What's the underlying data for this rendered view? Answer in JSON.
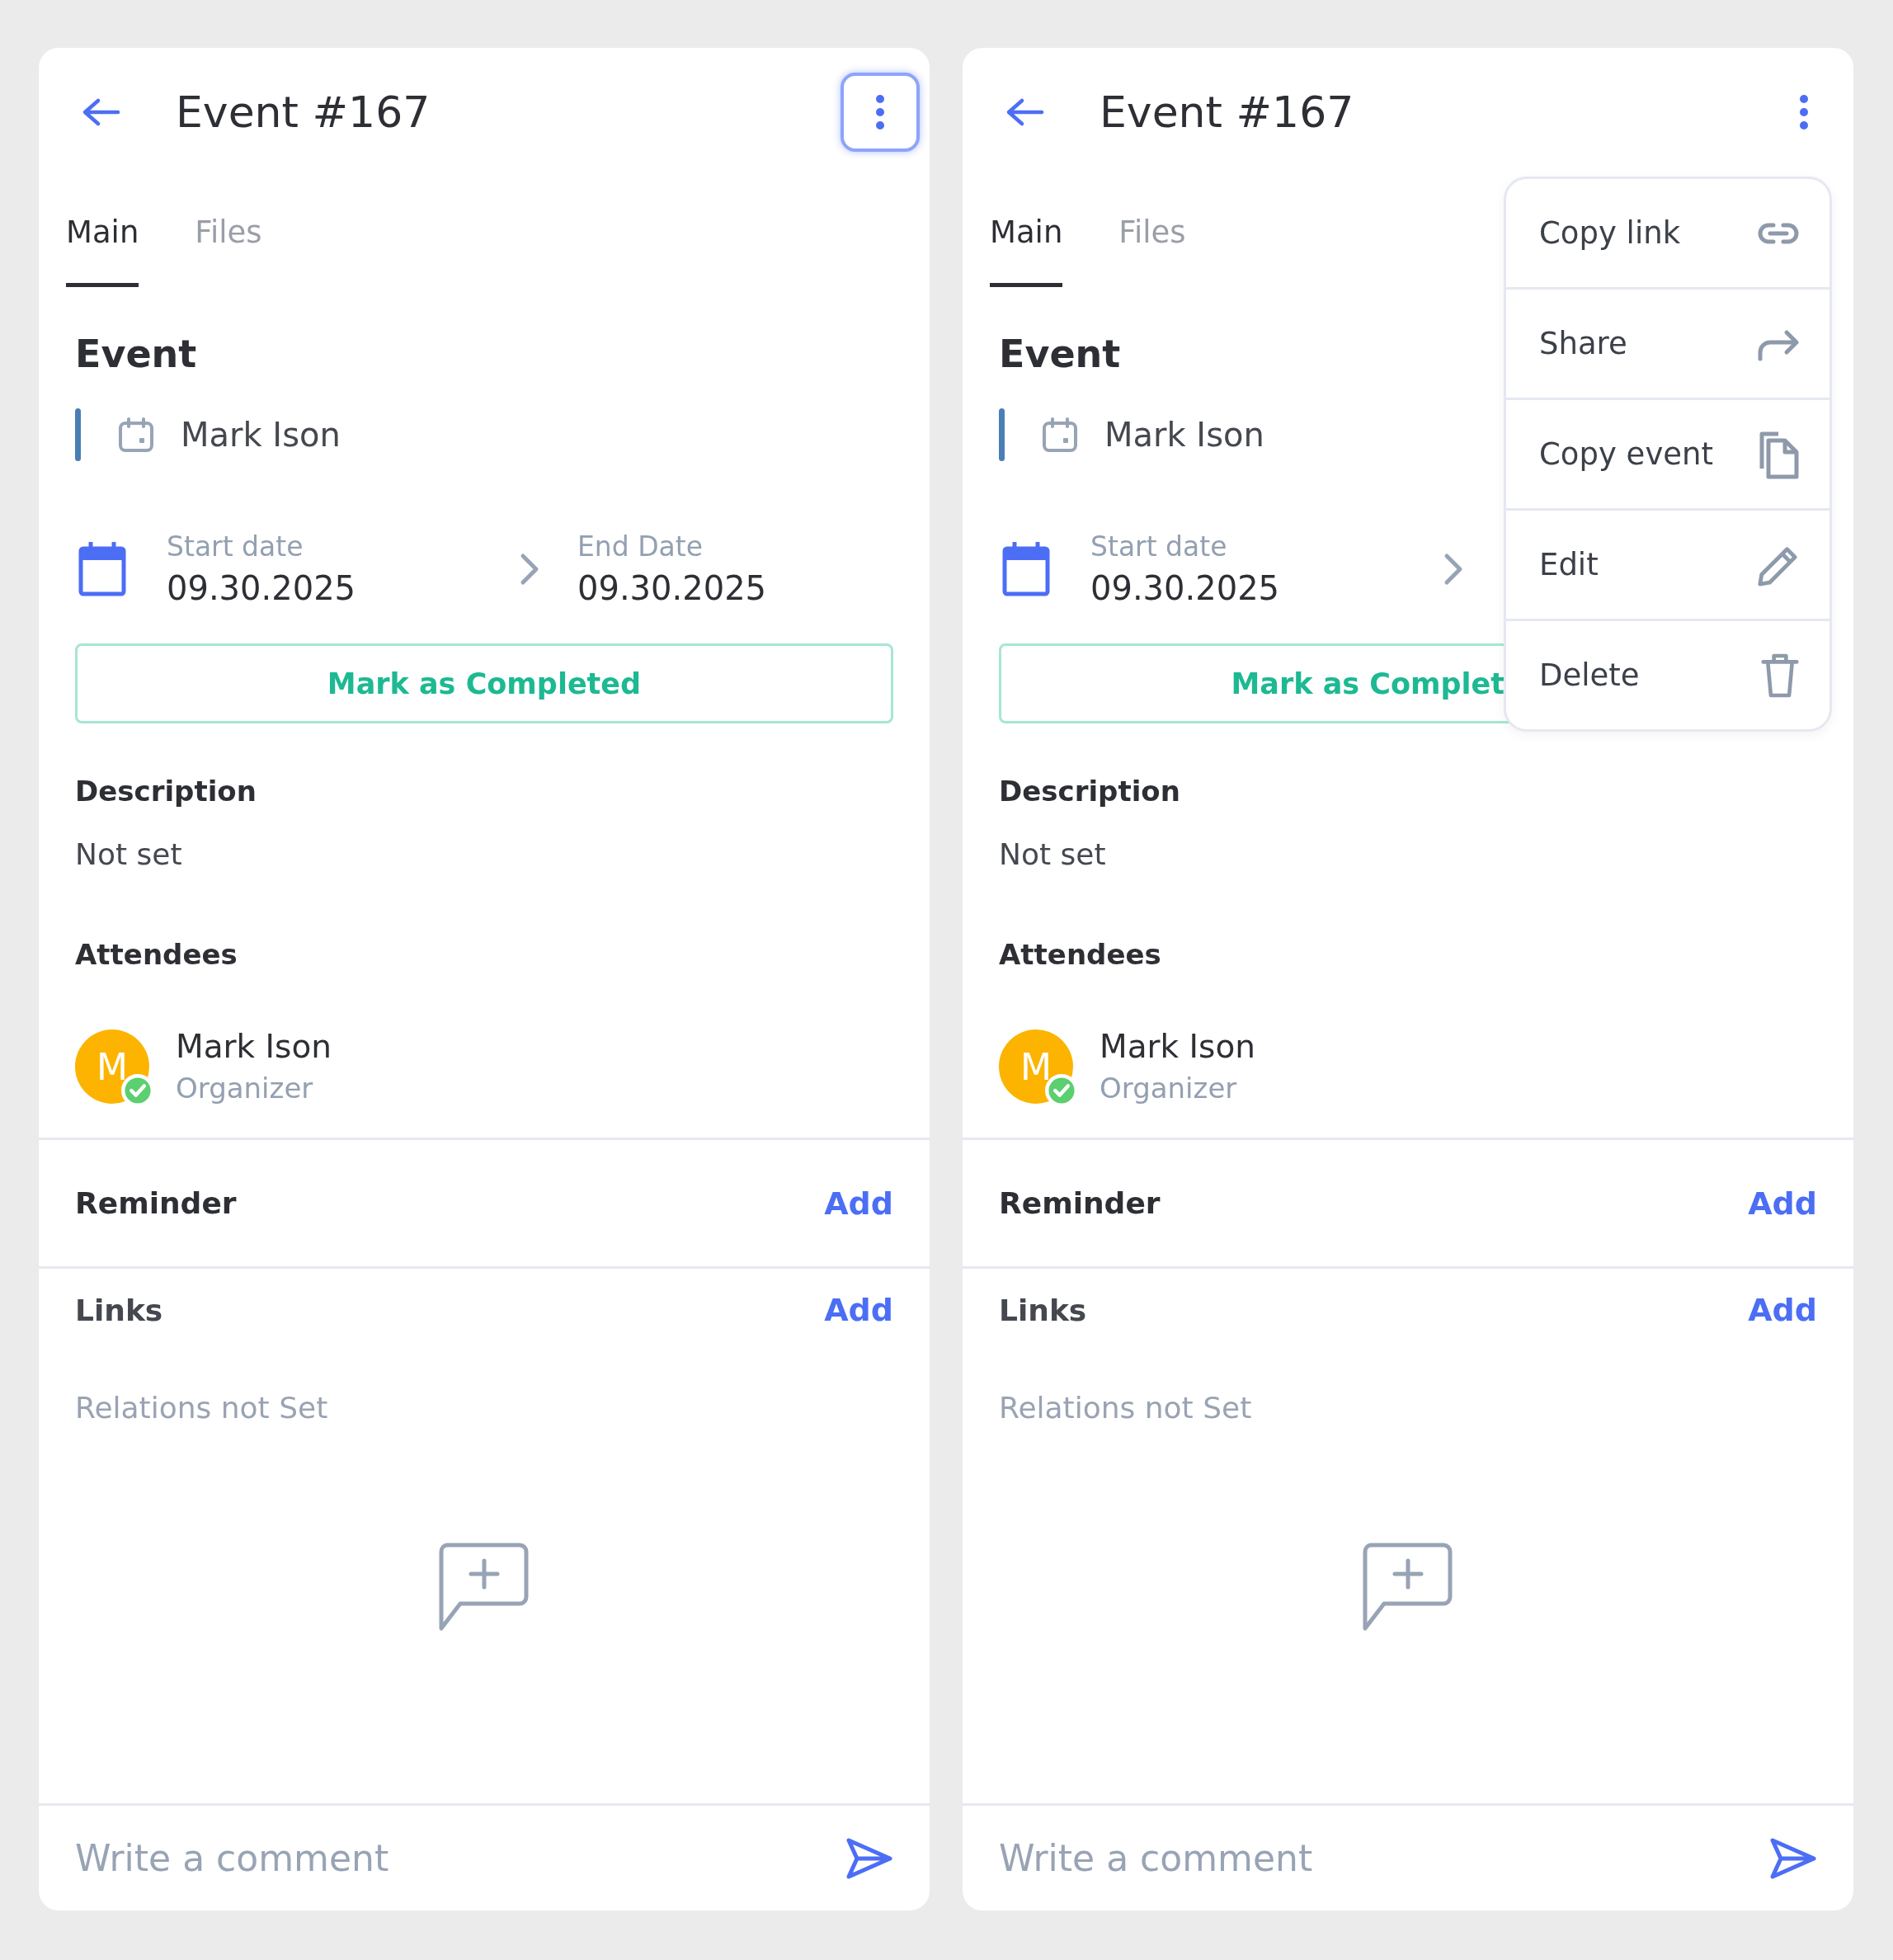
{
  "panels": [
    {
      "header": {
        "title": "Event #167",
        "more_button": {
          "focused": true
        }
      },
      "tabs": [
        {
          "label": "Main",
          "selected": true
        },
        {
          "label": "Files",
          "selected": false
        }
      ],
      "section_title": "Event",
      "calendar_name": "Mark Ison",
      "start_date": {
        "label": "Start date",
        "value": "09.30.2025"
      },
      "end_date": {
        "label": "End Date",
        "value": "09.30.2025"
      },
      "complete_button": "Mark as Completed",
      "description": {
        "label": "Description",
        "value": "Not set"
      },
      "attendees": {
        "label": "Attendees",
        "items": [
          {
            "initial": "M",
            "name": "Mark Ison",
            "role": "Organizer",
            "accepted": true
          }
        ]
      },
      "reminder": {
        "label": "Reminder",
        "action": "Add"
      },
      "links": {
        "label": "Links",
        "action": "Add",
        "empty": "Relations not Set"
      },
      "comment": {
        "placeholder": "Write a comment"
      }
    },
    {
      "header": {
        "title": "Event #167",
        "more_button": {
          "focused": false
        }
      },
      "tabs": [
        {
          "label": "Main",
          "selected": true
        },
        {
          "label": "Files",
          "selected": false
        }
      ],
      "section_title": "Event",
      "calendar_name": "Mark Ison",
      "start_date": {
        "label": "Start date",
        "value": "09.30.2025"
      },
      "complete_button": "Mark as Complet",
      "description": {
        "label": "Description",
        "value": "Not set"
      },
      "attendees": {
        "label": "Attendees",
        "items": [
          {
            "initial": "M",
            "name": "Mark Ison",
            "role": "Organizer",
            "accepted": true
          }
        ]
      },
      "reminder": {
        "label": "Reminder",
        "action": "Add"
      },
      "links": {
        "label": "Links",
        "action": "Add",
        "empty": "Relations not Set"
      },
      "comment": {
        "placeholder": "Write a comment"
      },
      "menu": {
        "items": [
          {
            "label": "Copy link",
            "kind": "link"
          },
          {
            "label": "Share",
            "kind": "share"
          },
          {
            "label": "Copy event",
            "kind": "copy"
          },
          {
            "label": "Edit",
            "kind": "edit"
          },
          {
            "label": "Delete",
            "kind": "delete"
          }
        ]
      }
    }
  ]
}
